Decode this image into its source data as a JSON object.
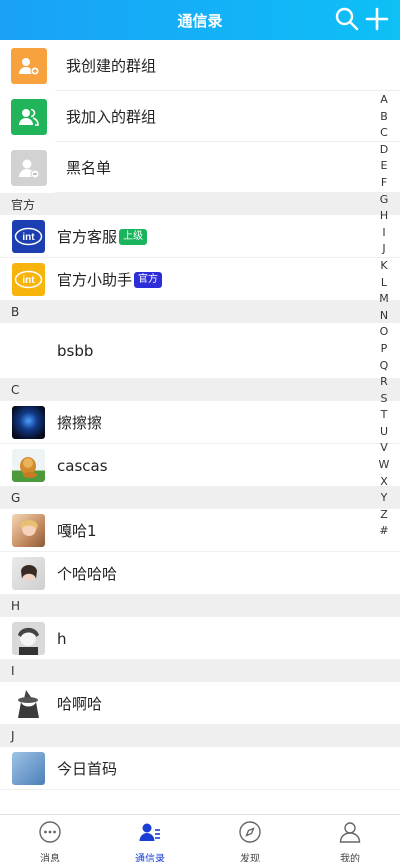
{
  "header": {
    "title": "通信录",
    "search_icon": "search-icon",
    "add_icon": "plus-icon"
  },
  "groups": [
    {
      "label": "我创建的群组",
      "color": "#f7a13f",
      "icon": "group-add-icon"
    },
    {
      "label": "我加入的群组",
      "color": "#22b45a",
      "icon": "group-icon"
    },
    {
      "label": "黑名单",
      "color": "#d2d2d2",
      "icon": "blocked-user-icon"
    }
  ],
  "sections": [
    {
      "letter": "官方",
      "contacts": [
        {
          "name": "官方客服",
          "badge": "上级",
          "badge_color": "#19b45c",
          "avatar": "intel-logo-blue"
        },
        {
          "name": "官方小助手",
          "badge": "官方",
          "badge_color": "#2d2dd9",
          "avatar": "intel-logo-yellow"
        }
      ]
    },
    {
      "letter": "B",
      "contacts": [
        {
          "name": "bsbb",
          "avatar": "none"
        }
      ]
    },
    {
      "letter": "C",
      "contacts": [
        {
          "name": "擦擦擦",
          "avatar": "dark-photo"
        },
        {
          "name": "cascas",
          "avatar": "lion-cartoon"
        }
      ]
    },
    {
      "letter": "G",
      "contacts": [
        {
          "name": "嘎哈1",
          "avatar": "person-photo"
        },
        {
          "name": "个哈哈哈",
          "avatar": "person-photo-2"
        }
      ]
    },
    {
      "letter": "H",
      "contacts": [
        {
          "name": "h",
          "avatar": "anime-boy"
        }
      ]
    },
    {
      "letter": "I",
      "contacts": [
        {
          "name": "哈啊哈",
          "avatar": "witch-figure"
        }
      ]
    },
    {
      "letter": "J",
      "contacts": [
        {
          "name": "今日首码",
          "avatar": "blue-photo"
        }
      ]
    }
  ],
  "index_letters": [
    "A",
    "B",
    "C",
    "D",
    "E",
    "F",
    "G",
    "H",
    "I",
    "J",
    "K",
    "L",
    "M",
    "N",
    "O",
    "P",
    "Q",
    "R",
    "S",
    "T",
    "U",
    "V",
    "W",
    "X",
    "Y",
    "Z",
    "#"
  ],
  "tabs": [
    {
      "label": "消息",
      "icon": "chat-bubble-icon",
      "active": false
    },
    {
      "label": "通信录",
      "icon": "contacts-icon",
      "active": true
    },
    {
      "label": "发现",
      "icon": "compass-icon",
      "active": false
    },
    {
      "label": "我的",
      "icon": "user-icon",
      "active": false
    }
  ],
  "colors": {
    "header": "#12b3f7",
    "active_tab": "#1a3fd4"
  }
}
